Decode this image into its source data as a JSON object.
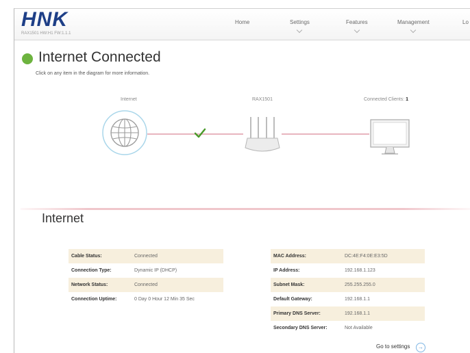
{
  "header": {
    "logo": "HNK",
    "firmware": "RAX1501 HW:H1 FW:1.1.1",
    "nav": [
      {
        "label": "Home"
      },
      {
        "label": "Settings"
      },
      {
        "label": "Features"
      },
      {
        "label": "Management"
      },
      {
        "label": "Lo"
      }
    ]
  },
  "status": {
    "title": "Internet Connected",
    "subtitle": "Click on any item in the diagram for more information.",
    "color": "#6db33f"
  },
  "diagram": {
    "internet_label": "Internet",
    "router_label": "RAX1501",
    "clients_label": "Connected Clients:",
    "clients_count": "1",
    "icons": [
      "globe-icon",
      "checkmark-icon",
      "router-icon",
      "monitor-icon"
    ]
  },
  "internet": {
    "title": "Internet",
    "left": [
      {
        "key": "Cable Status:",
        "value": "Connected"
      },
      {
        "key": "Connection Type:",
        "value": "Dynamic IP (DHCP)"
      },
      {
        "key": "Network Status:",
        "value": "Connected"
      },
      {
        "key": "Connection Uptime:",
        "value": "0 Day 0 Hour 12 Min 35 Sec"
      }
    ],
    "right": [
      {
        "key": "MAC Address:",
        "value": "DC:4E:F4:0E:E3:5D"
      },
      {
        "key": "IP Address:",
        "value": "192.168.1.123"
      },
      {
        "key": "Subnet Mask:",
        "value": "255.255.255.0"
      },
      {
        "key": "Default Gateway:",
        "value": "192.168.1.1"
      },
      {
        "key": "Primary DNS Server:",
        "value": "192.168.1.1"
      },
      {
        "key": "Secondary DNS Server:",
        "value": "Not Available"
      }
    ],
    "goto_settings": "Go to settings"
  }
}
